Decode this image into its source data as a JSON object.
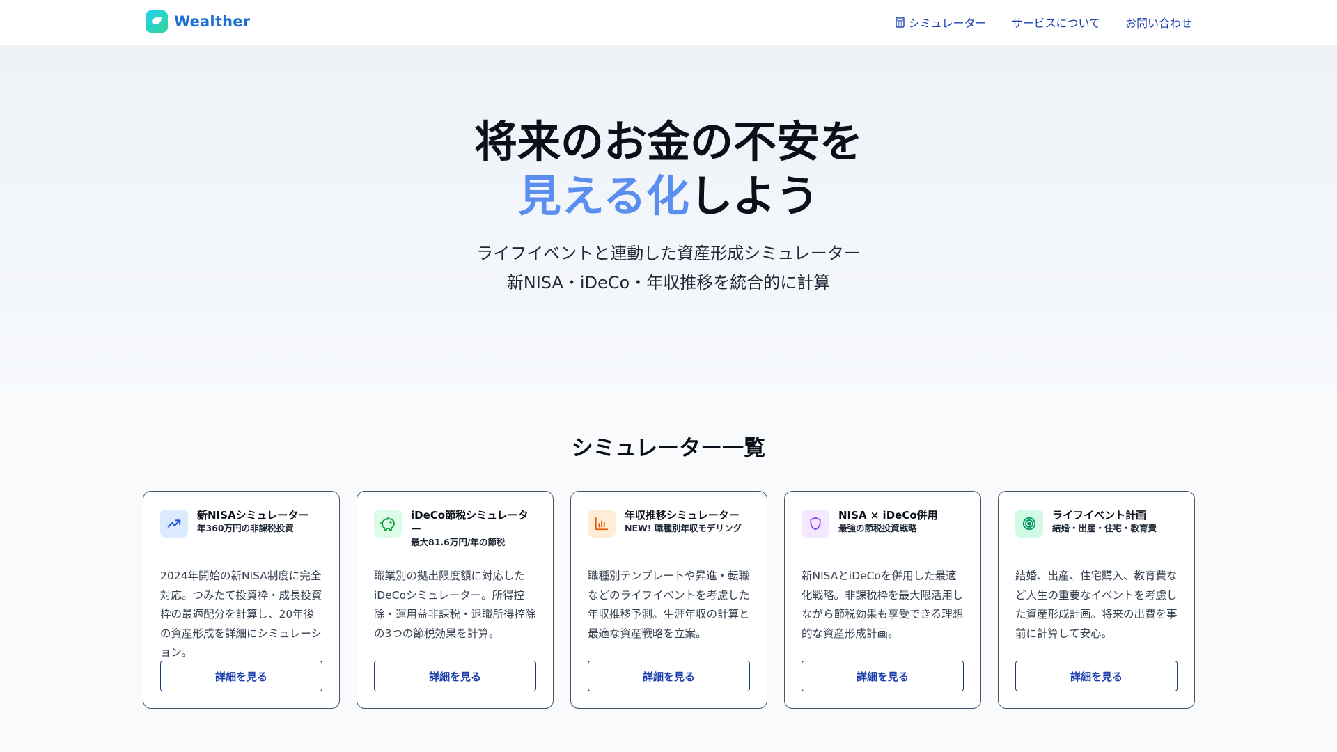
{
  "header": {
    "brand_name": "Wealther",
    "nav": {
      "simulator": "シミュレーター",
      "about": "サービスについて",
      "contact": "お問い合わせ"
    }
  },
  "hero": {
    "title_line1": "将来のお金の不安を",
    "title_accent": "見える化",
    "title_rest": "しよう",
    "subtitle_line1": "ライフイベントと連動した資産形成シミュレーター",
    "subtitle_line2": "新NISA・iDeCo・年収推移を統合的に計算"
  },
  "section": {
    "title": "シミュレーター一覧"
  },
  "cards": [
    {
      "icon": "trending-up-icon",
      "icon_bg": "#dbeafe",
      "icon_color": "#1d4ed8",
      "title": "新NISAシミュレーター",
      "subtitle": "年360万円の非課税投資",
      "description": "2024年開始の新NISA制度に完全対応。つみたて投資枠・成長投資枠の最適配分を計算し、20年後の資産形成を詳細にシミュレーション。",
      "button": "詳細を見る"
    },
    {
      "icon": "piggy-bank-icon",
      "icon_bg": "#dcfce7",
      "icon_color": "#16a34a",
      "title": "iDeCo節税シミュレーター",
      "subtitle": "最大81.6万円/年の節税",
      "description": "職業別の拠出限度額に対応したiDeCoシミュレーター。所得控除・運用益非課税・退職所得控除の3つの節税効果を計算。",
      "button": "詳細を見る"
    },
    {
      "icon": "bar-chart-icon",
      "icon_bg": "#ffedd5",
      "icon_color": "#ea580c",
      "title": "年収推移シミュレーター",
      "subtitle": "NEW! 職種別年収モデリング",
      "description": "職種別テンプレートや昇進・転職などのライフイベントを考慮した年収推移予測。生涯年収の計算と最適な資産戦略を立案。",
      "button": "詳細を見る"
    },
    {
      "icon": "shield-icon",
      "icon_bg": "#f3e8ff",
      "icon_color": "#7c3aed",
      "title": "NISA × iDeCo併用",
      "subtitle": "最強の節税投資戦略",
      "description": "新NISAとiDeCoを併用した最適化戦略。非課税枠を最大限活用しながら節税効果も享受できる理想的な資産形成計画。",
      "button": "詳細を見る"
    },
    {
      "icon": "target-icon",
      "icon_bg": "#d1fae5",
      "icon_color": "#059669",
      "title": "ライフイベント計画",
      "subtitle": "結婚・出産・住宅・教育費",
      "description": "結婚、出産、住宅購入、教育費など人生の重要なイベントを考慮した資産形成計画。将来の出費を事前に計算して安心。",
      "button": "詳細を見る"
    }
  ]
}
